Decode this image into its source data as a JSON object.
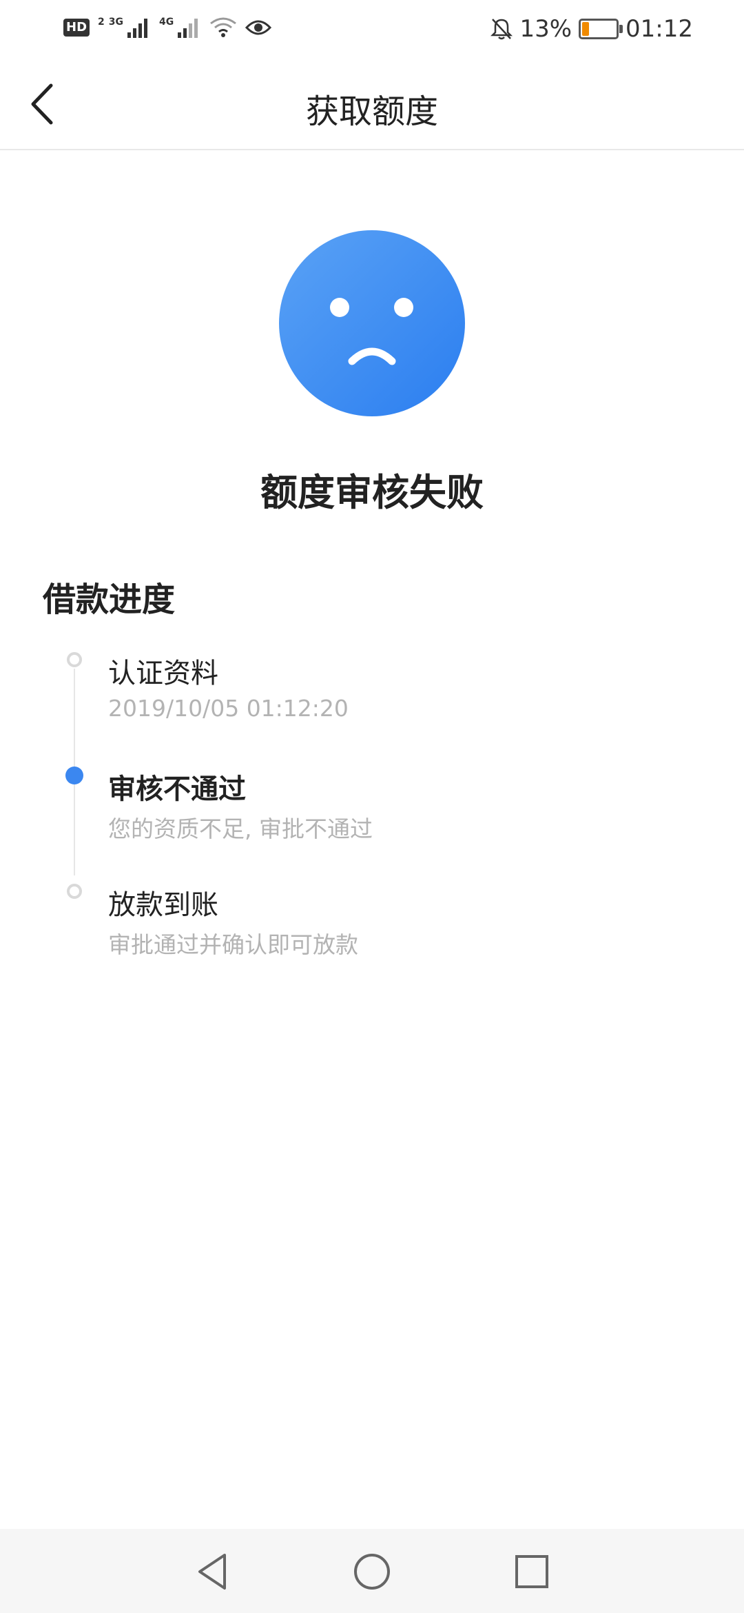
{
  "status_bar": {
    "hd": "HD",
    "hd_sub": "2",
    "net1": "3G",
    "net2": "4G",
    "battery": "13%",
    "time": "01:12"
  },
  "nav": {
    "title": "获取额度"
  },
  "result": {
    "title": "额度审核失败"
  },
  "progress": {
    "title": "借款进度",
    "steps": [
      {
        "title": "认证资料",
        "subtitle": "2019/10/05 01:12:20",
        "state": "done"
      },
      {
        "title": "审核不通过",
        "subtitle": "您的资质不足, 审批不通过",
        "state": "current"
      },
      {
        "title": "放款到账",
        "subtitle": "审批通过并确认即可放款",
        "state": "pending"
      }
    ]
  },
  "colors": {
    "accent": "#3b87f0",
    "battery_low": "#f08a00"
  }
}
